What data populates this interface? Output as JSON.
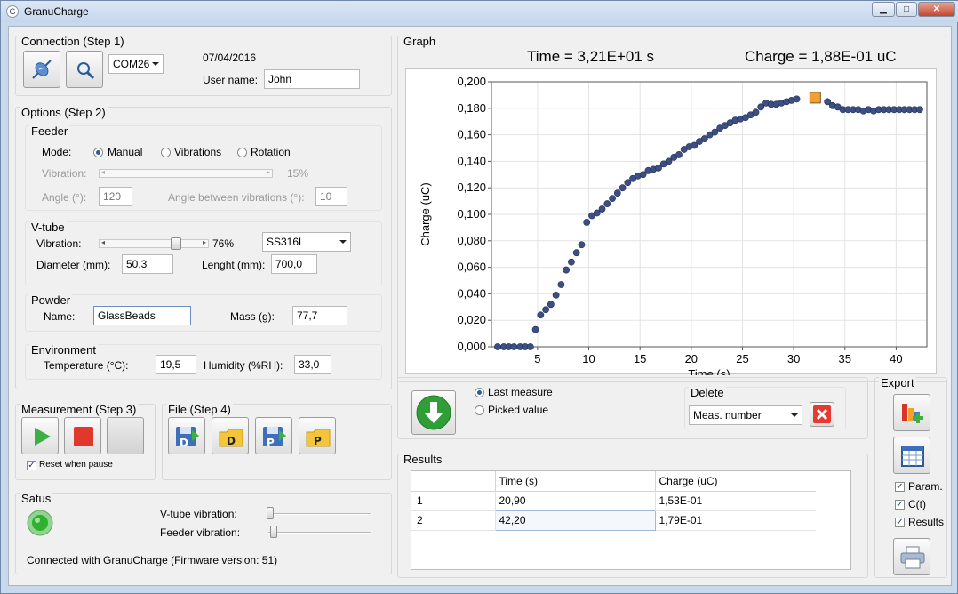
{
  "window": {
    "title": "GranuCharge",
    "minimize": "▁",
    "maximize": "□",
    "close": "✕",
    "app_icon": "G"
  },
  "connection": {
    "title": "Connection (Step 1)",
    "com_port": "COM26",
    "date": "07/04/2016",
    "user_label": "User name:",
    "user_value": "John",
    "connect_icon": "connector-icon",
    "search_icon": "magnifier-icon"
  },
  "options": {
    "title": "Options (Step 2)",
    "feeder": {
      "title": "Feeder",
      "mode_label": "Mode:",
      "modes": [
        {
          "label": "Manual",
          "selected": true
        },
        {
          "label": "Vibrations",
          "selected": false
        },
        {
          "label": "Rotation",
          "selected": false
        }
      ],
      "vibration_label": "Vibration:",
      "vibration_value": "15%",
      "vibration_level": 0.15,
      "angle_label": "Angle (°):",
      "angle_value": "120",
      "angle_between_label": "Angle between vibrations (°):",
      "angle_between_value": "10"
    },
    "vtube": {
      "title": "V-tube",
      "vibration_label": "Vibration:",
      "vibration_value": "76%",
      "vibration_level": 0.76,
      "material": "SS316L",
      "diameter_label": "Diameter (mm):",
      "diameter_value": "50,3",
      "length_label": "Lenght (mm):",
      "length_value": "700,0"
    },
    "powder": {
      "title": "Powder",
      "name_label": "Name:",
      "name_value": "GlassBeads",
      "mass_label": "Mass (g):",
      "mass_value": "77,7"
    },
    "environment": {
      "title": "Environment",
      "temperature_label": "Temperature (°C):",
      "temperature_value": "19,5",
      "humidity_label": "Humidity (%RH):",
      "humidity_value": "33,0"
    }
  },
  "measurement": {
    "title": "Measurement (Step 3)",
    "reset_label": "Reset when pause",
    "reset_checked": true
  },
  "file": {
    "title": "File (Step 4)",
    "buttons": [
      "D",
      "D",
      "P",
      "P"
    ]
  },
  "status": {
    "title": "Satus",
    "vtube_label": "V-tube vibration:",
    "feeder_label": "Feeder vibration:",
    "message": "Connected with GranuCharge (Firmware version: 51)",
    "led_color": "#2fb02f"
  },
  "graph": {
    "title": "Graph",
    "time_readout": "Time = 3,21E+01 s",
    "charge_readout": "Charge = 1,88E-01 uC"
  },
  "picker": {
    "last_measure": "Last measure",
    "picked_value": "Picked value",
    "selected": "last",
    "delete_title": "Delete",
    "delete_mode": "Meas. number",
    "download_icon": "green-down-arrow-icon",
    "delete_icon": "red-x-icon"
  },
  "results": {
    "title": "Results",
    "columns": [
      "",
      "Time (s)",
      "Charge (uC)"
    ],
    "rows": [
      [
        "1",
        "20,90",
        "1,53E-01"
      ],
      [
        "2",
        "42,20",
        "1,79E-01"
      ]
    ]
  },
  "export": {
    "title": "Export",
    "param_label": "Param.",
    "ct_label": "C(t)",
    "results_label": "Results",
    "param_checked": true,
    "ct_checked": true,
    "results_checked": true
  },
  "chart_data": {
    "type": "scatter",
    "xlabel": "Time (s)",
    "ylabel": "Charge (uC)",
    "xlim": [
      0.5,
      43
    ],
    "ylim": [
      0,
      0.2
    ],
    "x_ticks": [
      "5",
      "10",
      "15",
      "20",
      "25",
      "30",
      "35",
      "40"
    ],
    "y_ticks": [
      "0,000",
      "0,020",
      "0,040",
      "0,060",
      "0,080",
      "0,100",
      "0,120",
      "0,140",
      "0,160",
      "0,180",
      "0,200"
    ],
    "grid": true,
    "marker_color": "#3d4f82",
    "highlight_color": "#f0a035",
    "highlight_index": 59,
    "x": [
      1.1,
      1.7,
      2.2,
      2.7,
      3.3,
      3.8,
      4.3,
      4.8,
      5.3,
      5.8,
      6.3,
      6.8,
      7.3,
      7.8,
      8.3,
      8.8,
      9.3,
      9.8,
      10.3,
      10.8,
      11.3,
      11.8,
      12.3,
      12.8,
      13.3,
      13.8,
      14.3,
      14.8,
      15.3,
      15.8,
      16.3,
      16.8,
      17.3,
      17.8,
      18.3,
      18.8,
      19.3,
      19.8,
      20.3,
      20.8,
      21.3,
      21.8,
      22.3,
      22.8,
      23.3,
      23.8,
      24.3,
      24.8,
      25.3,
      25.8,
      26.3,
      26.8,
      27.3,
      27.8,
      28.3,
      28.8,
      29.3,
      29.8,
      30.3,
      32.1,
      33.3,
      33.8,
      34.3,
      34.8,
      35.3,
      35.8,
      36.3,
      36.8,
      37.3,
      37.8,
      38.3,
      38.8,
      39.3,
      39.8,
      40.3,
      40.8,
      41.3,
      41.8,
      42.3
    ],
    "y": [
      0,
      0,
      0,
      0,
      0,
      0,
      0,
      0.013,
      0.024,
      0.028,
      0.032,
      0.039,
      0.047,
      0.058,
      0.064,
      0.071,
      0.077,
      0.094,
      0.099,
      0.101,
      0.104,
      0.108,
      0.112,
      0.116,
      0.12,
      0.124,
      0.127,
      0.129,
      0.13,
      0.133,
      0.134,
      0.135,
      0.138,
      0.14,
      0.143,
      0.145,
      0.149,
      0.151,
      0.152,
      0.155,
      0.157,
      0.16,
      0.162,
      0.165,
      0.167,
      0.169,
      0.171,
      0.172,
      0.173,
      0.175,
      0.177,
      0.181,
      0.184,
      0.183,
      0.183,
      0.184,
      0.185,
      0.186,
      0.187,
      0.188,
      0.185,
      0.182,
      0.181,
      0.179,
      0.179,
      0.179,
      0.179,
      0.178,
      0.179,
      0.178,
      0.179,
      0.179,
      0.179,
      0.179,
      0.179,
      0.179,
      0.179,
      0.179,
      0.179
    ]
  }
}
